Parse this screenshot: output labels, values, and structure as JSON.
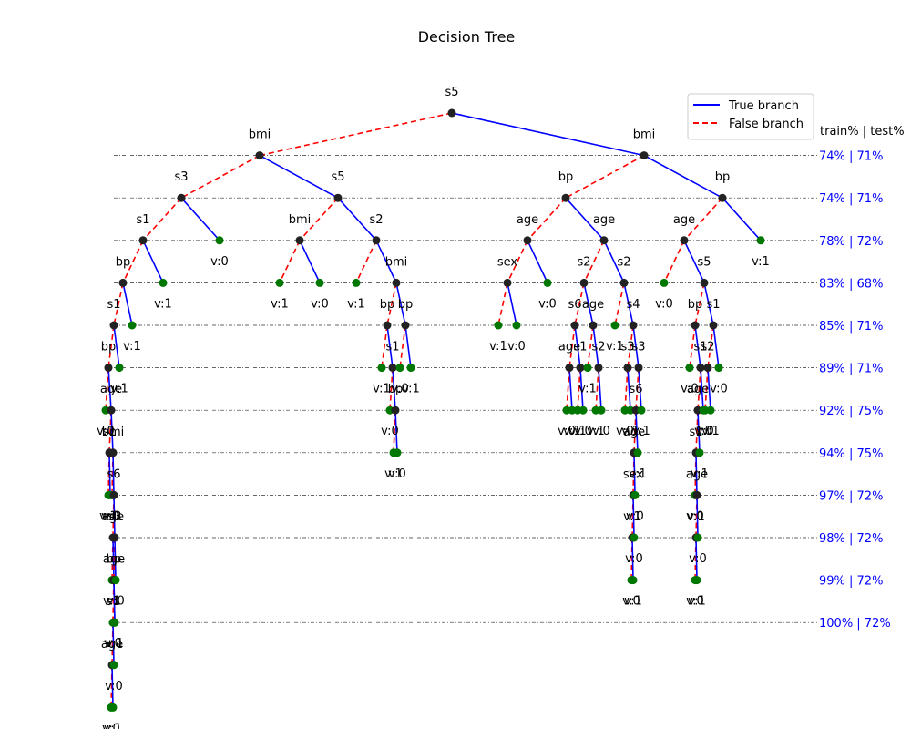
{
  "title": "Decision Tree",
  "legend": {
    "true_label": "True branch",
    "false_label": "False branch",
    "true_color": "#0000ff",
    "false_color": "#ff0000"
  },
  "level_header": "train% | test%",
  "colors": {
    "internal_node": "#222222",
    "leaf_node": "#007700",
    "level_text": "#0000ff"
  },
  "levels": [
    {
      "depth": 1,
      "label": "74% | 71%"
    },
    {
      "depth": 2,
      "label": "74% | 71%"
    },
    {
      "depth": 3,
      "label": "78% | 72%"
    },
    {
      "depth": 4,
      "label": "83% | 68%"
    },
    {
      "depth": 5,
      "label": "85% | 71%"
    },
    {
      "depth": 6,
      "label": "89% | 71%"
    },
    {
      "depth": 7,
      "label": "92% | 75%"
    },
    {
      "depth": 8,
      "label": "94% | 75%"
    },
    {
      "depth": 9,
      "label": "97% | 72%"
    },
    {
      "depth": 10,
      "label": "98% | 72%"
    },
    {
      "depth": 11,
      "label": "99% | 72%"
    },
    {
      "depth": 12,
      "label": "100% | 72%"
    }
  ],
  "tree": {
    "label": "s5",
    "false": {
      "label": "bmi",
      "false": {
        "label": "s3",
        "false": {
          "label": "s1",
          "false": {
            "label": "bp",
            "false": {
              "label": "s1",
              "false": {
                "label": "bp",
                "false": {
                  "label": "v:0"
                },
                "true": {
                  "label": "age",
                  "false": {
                    "label": "s1",
                    "false": {
                      "label": "v:1"
                    },
                    "true": {
                      "label": "v:0"
                    }
                  },
                  "true": {
                    "label": "bmi",
                    "false": {
                      "label": "v:0"
                    },
                    "true": {
                      "label": "s6",
                      "false": {
                        "label": "age",
                        "false": {
                          "label": "v:1"
                        },
                        "true": {
                          "label": "bp",
                          "false": {
                            "label": "s1",
                            "false": {
                              "label": "age",
                              "false": {
                                "label": "v:0"
                              },
                              "true": {
                                "label": "v:1"
                              }
                            },
                            "true": {
                              "label": "v:0"
                            }
                          },
                          "true": {
                            "label": "v:1"
                          }
                        }
                      },
                      "true": {
                        "label": "s3",
                        "false": {
                          "label": "age",
                          "false": {
                            "label": "v:0"
                          },
                          "true": {
                            "label": "v:1"
                          }
                        },
                        "true": {
                          "label": "v:0"
                        }
                      }
                    }
                  }
                }
              },
              "true": {
                "label": "v:1"
              }
            },
            "true": {
              "label": "v:1"
            }
          },
          "true": {
            "label": "v:1"
          }
        },
        "true": {
          "label": "v:0"
        }
      },
      "true": {
        "label": "s5",
        "false": {
          "label": "bmi",
          "false": {
            "label": "v:1"
          },
          "true": {
            "label": "v:0"
          }
        },
        "true": {
          "label": "s2",
          "false": {
            "label": "v:1"
          },
          "true": {
            "label": "bmi",
            "false": {
              "label": "bp",
              "false": {
                "label": "v:1"
              },
              "true": {
                "label": "s1",
                "false": {
                  "label": "v:0"
                },
                "true": {
                  "label": "bp",
                  "false": {
                    "label": "v:1"
                  },
                  "true": {
                    "label": "v:0",
                    "false": null
                  }
                }
              }
            },
            "true": {
              "label": "bp",
              "false": {
                "label": "v:0"
              },
              "true": {
                "label": "v:1"
              }
            }
          }
        }
      }
    },
    "true": {
      "label": "bmi",
      "false": {
        "label": "bp",
        "false": {
          "label": "age",
          "false": {
            "label": "sex",
            "false": {
              "label": "v:1"
            },
            "true": {
              "label": "v:0"
            }
          },
          "true": {
            "label": "v:0"
          }
        },
        "true": {
          "label": "age",
          "false": {
            "label": "s2",
            "false": {
              "label": "s6",
              "false": {
                "label": "age",
                "false": {
                  "label": "v:0"
                },
                "true": {
                  "label": "v:1"
                }
              },
              "true": {
                "label": "s1",
                "false": {
                  "label": "v:1"
                },
                "true": {
                  "label": "v:0"
                }
              }
            },
            "true": {
              "label": "age",
              "false": {
                "label": "v:1"
              },
              "true": {
                "label": "s2",
                "false": {
                  "label": "v:1"
                },
                "true": {
                  "label": "v:0"
                }
              }
            }
          },
          "true": {
            "label": "s2",
            "false": {
              "label": "v:1"
            },
            "true": {
              "label": "s4",
              "false": {
                "label": "s3",
                "false": {
                  "label": "v:0"
                },
                "true": {
                  "label": "v:1"
                }
              },
              "true": {
                "label": "s3",
                "false": {
                  "label": "s6",
                  "false": {
                    "label": "age",
                    "false": {
                      "label": "sex",
                      "false": {
                        "label": "v:1",
                        "false": {
                          "label": "v:0"
                        },
                        "true": {
                          "label": "v:1"
                        }
                      },
                      "true": {
                        "label": "v:0"
                      }
                    },
                    "true": {
                      "label": "v:0"
                    }
                  },
                  "true": {
                    "label": "v:1"
                  }
                },
                "true": {
                  "label": "v:1"
                }
              }
            }
          }
        }
      },
      "true": {
        "label": "bp",
        "false": {
          "label": "age",
          "false": {
            "label": "v:0"
          },
          "true": {
            "label": "s5",
            "false": {
              "label": "bp",
              "false": {
                "label": "v:0"
              },
              "true": {
                "label": "s1",
                "false": {
                  "label": "age",
                  "false": {
                    "label": "s1",
                    "false": {
                      "label": "v:0"
                    },
                    "true": {
                      "label": "age",
                      "false": {
                        "label": "v:1",
                        "false": {
                          "label": "v:0"
                        },
                        "true": {
                          "label": "v:1"
                        }
                      },
                      "true": {
                        "label": "v:0"
                      }
                    }
                  },
                  "true": {
                    "label": "v:1"
                  }
                },
                "true": {
                  "label": "v:0"
                }
              }
            },
            "true": {
              "label": "s1",
              "false": {
                "label": "s2",
                "false": {
                  "label": "v:0"
                },
                "true": {
                  "label": "v:1"
                }
              },
              "true": {
                "label": "v:0"
              }
            }
          }
        },
        "true": {
          "label": "v:1"
        }
      }
    }
  }
}
